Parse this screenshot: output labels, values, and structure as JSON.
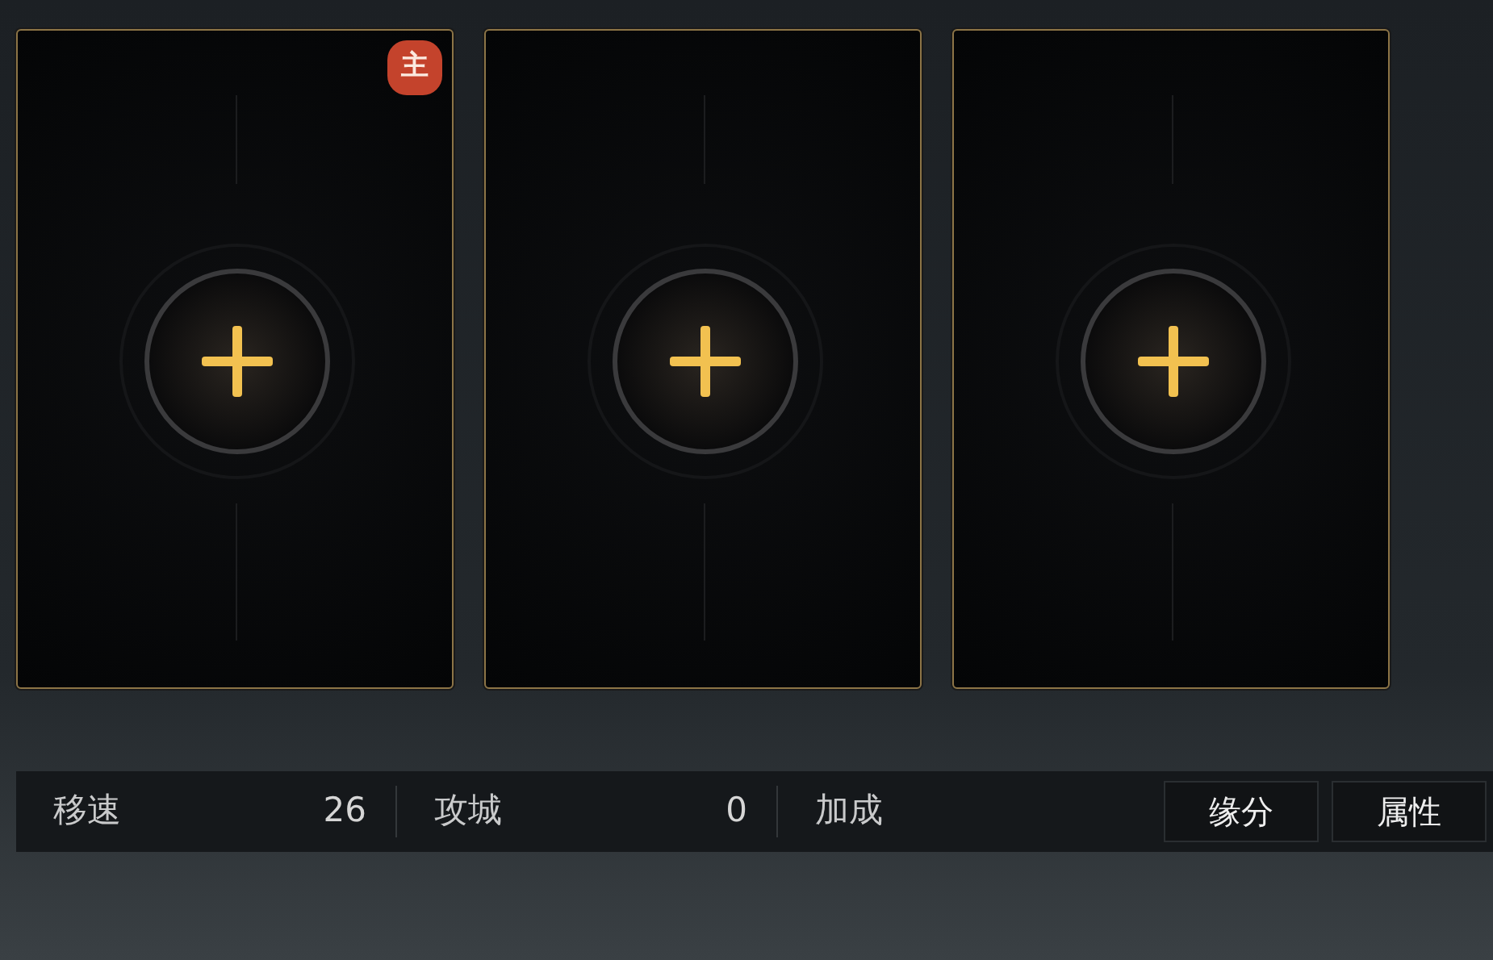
{
  "slots": [
    {
      "main": true,
      "badge": "主"
    },
    {
      "main": false
    },
    {
      "main": false
    }
  ],
  "stats": [
    {
      "label": "移速",
      "value": "26"
    },
    {
      "label": "攻城",
      "value": "0"
    },
    {
      "label": "加成"
    }
  ],
  "buttons": [
    "缘分",
    "属性"
  ]
}
